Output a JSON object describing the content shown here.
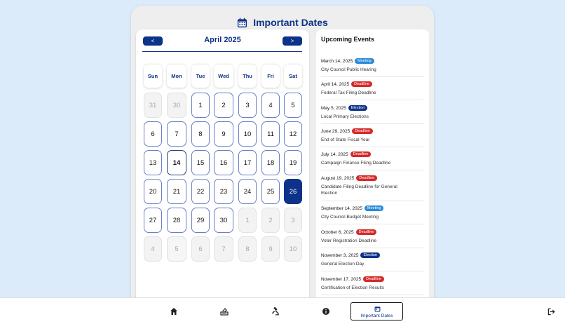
{
  "header": {
    "title": "Important Dates",
    "icon": "calendar-icon"
  },
  "calendar": {
    "month_label": "April 2025",
    "prev_label": "<",
    "next_label": ">",
    "weekdays": [
      "Sun",
      "Mon",
      "Tue",
      "Wed",
      "Thu",
      "Fri",
      "Sat"
    ],
    "weeks": [
      [
        "31",
        "30",
        "1",
        "2",
        "3",
        "4",
        "5"
      ],
      [
        "6",
        "7",
        "8",
        "9",
        "10",
        "11",
        "12"
      ],
      [
        "13",
        "14",
        "15",
        "16",
        "17",
        "18",
        "19"
      ],
      [
        "20",
        "21",
        "22",
        "23",
        "24",
        "25",
        "26"
      ],
      [
        "27",
        "28",
        "29",
        "30",
        "1",
        "2",
        "3"
      ],
      [
        "4",
        "5",
        "6",
        "7",
        "8",
        "9",
        "10"
      ]
    ],
    "today": "14",
    "selected": "26"
  },
  "events": {
    "title": "Upcoming Events",
    "items": [
      {
        "date": "March 14, 2025",
        "type": "Meeting",
        "desc": "City Council Public Hearing"
      },
      {
        "date": "April 14, 2025",
        "type": "Deadline",
        "desc": "Federal Tax Filing Deadline"
      },
      {
        "date": "May 5, 2025",
        "type": "Election",
        "desc": "Local Primary Elections"
      },
      {
        "date": "June 29, 2025",
        "type": "Deadline",
        "desc": "End of State Fiscal Year"
      },
      {
        "date": "July 14, 2025",
        "type": "Deadline",
        "desc": "Campaign Finance Filing Deadline"
      },
      {
        "date": "August 19, 2025",
        "type": "Deadline",
        "desc": "Candidate Filing Deadline for General Election"
      },
      {
        "date": "September 14, 2025",
        "type": "Meeting",
        "desc": "City Council Budget Meeting"
      },
      {
        "date": "October 6, 2025",
        "type": "Deadline",
        "desc": "Voter Registration Deadline"
      },
      {
        "date": "November 3, 2025",
        "type": "Election",
        "desc": "General Election Day"
      },
      {
        "date": "November 17, 2025",
        "type": "Deadline",
        "desc": "Certification of Election Results"
      }
    ]
  },
  "badge_colors": {
    "Meeting": "#2a8ad8",
    "Deadline": "#d62a2a",
    "Election": "#0d3289"
  },
  "colors": {
    "accent": "#0d3289",
    "background": "#dcebfa"
  },
  "bottom_nav": {
    "items": [
      {
        "icon": "home-icon"
      },
      {
        "icon": "ballot-box-icon"
      },
      {
        "icon": "gavel-icon"
      },
      {
        "icon": "info-icon"
      },
      {
        "icon": "calendar-icon",
        "label": "Important Dates"
      }
    ],
    "logout_icon": "logout-icon"
  }
}
